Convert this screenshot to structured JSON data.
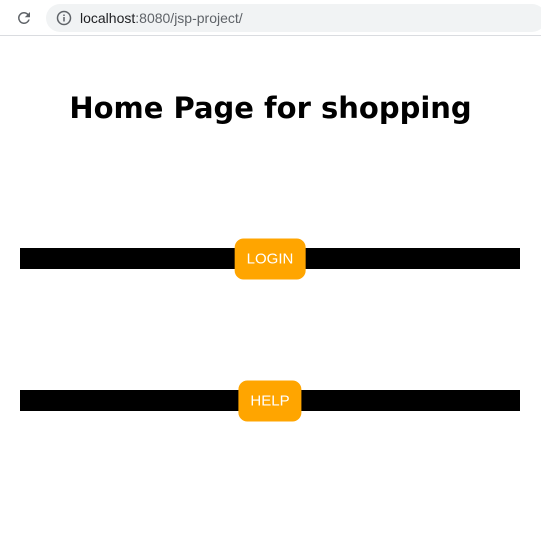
{
  "browser": {
    "url_host": "localhost",
    "url_rest": ":8080/jsp-project/"
  },
  "page": {
    "title": "Home Page for shopping"
  },
  "nav": {
    "login_label": "LOGIN",
    "help_label": "HELP"
  },
  "colors": {
    "button_bg": "#ffa500",
    "bar_bg": "#000000",
    "address_bg": "#f1f3f4"
  },
  "icons": {
    "reload": "reload-icon",
    "info": "info-icon"
  }
}
